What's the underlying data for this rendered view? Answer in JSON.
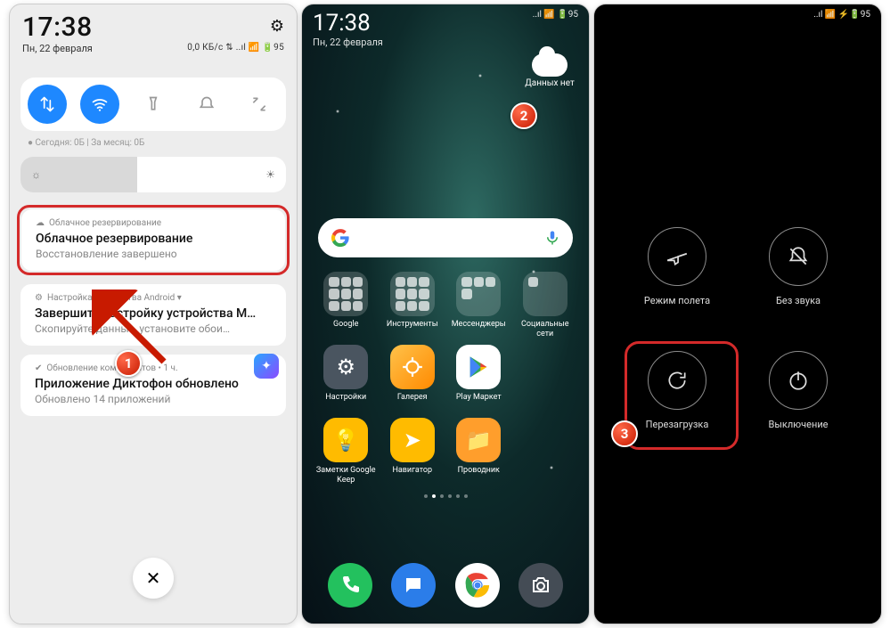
{
  "badges": {
    "one": "1",
    "two": "2",
    "three": "3"
  },
  "panel1": {
    "clock": "17:38",
    "date": "Пн, 22 февраля",
    "indicators": "0,0 КБ/с ⇅ ..ıl 📶 🔋95",
    "usage": "●  Сегодня: 0Б   |   За месяц: 0Б",
    "notif1": {
      "top": "Облачное резервирование",
      "title": "Облачное резервирование",
      "body": "Восстановление завершено"
    },
    "notif2": {
      "top": "Настройка устройства Android ▾",
      "title": "Завершите настройку устройства M…",
      "body": "Скопируйте данные, установите обои…"
    },
    "notif3": {
      "top": "Обновление компонентов • 1 ч.",
      "title": "Приложение Диктофон обновлено",
      "body": "Обновлено 14 приложений"
    }
  },
  "panel2": {
    "clock": "17:38",
    "date": "Пн, 22 февраля",
    "indicators": "..ıl 📶 🔋95",
    "weather": "Данных нет",
    "apps": {
      "google": "Google",
      "tools": "Инструменты",
      "messenger": "Мессенджеры",
      "social": "Социальные сети",
      "settings": "Настройки",
      "gallery": "Галерея",
      "play": "Play Маркет",
      "empty": "",
      "keep": "Заметки Google Keep",
      "nav": "Навигатор",
      "files": "Проводник"
    }
  },
  "panel3": {
    "indicators": "..ıl 📶 ⚡🔋95",
    "airplane": "Режим полета",
    "silent": "Без звука",
    "reboot": "Перезагрузка",
    "poweroff": "Выключение"
  }
}
